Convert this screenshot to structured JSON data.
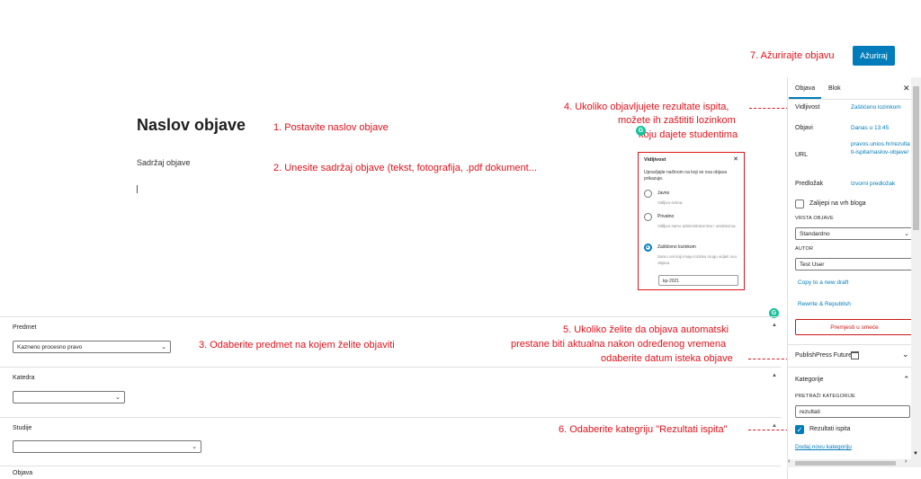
{
  "topbar": {
    "update_label": "Ažuriraj",
    "step7": "7. Ažurirajte objavu"
  },
  "editor": {
    "title": "Naslov objave",
    "content_placeholder": "Sadržaj objave"
  },
  "instructions": {
    "step1": "1. Postavite naslov objave",
    "step2": "2. Unesite sadržaj objave (tekst, fotografija, .pdf dokument...",
    "step3": "3. Odaberite predmet na kojem želite objaviti",
    "step4_line1": "4. Ukoliko objavljujete rezultate ispita,",
    "step4_line2": "možete ih zaštititi lozinkom",
    "step4_line3": "koju dajete studentima",
    "step5_line1": "5. Ukoliko želite da objava automatski",
    "step5_line2": "prestane biti aktualna nakon određenog vremena",
    "step5_line3": "odaberite datum isteka objave",
    "step6": "6. Odaberite kategriju \"Rezultati ispita\""
  },
  "visibility_popup": {
    "title": "Vidljivost",
    "intro": "Upravljajte načinom na koji se ova objava prikazuje.",
    "options": [
      {
        "label": "Javno",
        "desc": "Vidljivo svima."
      },
      {
        "label": "Privatno",
        "desc": "Vidljivo samo administratorima i urednicima."
      },
      {
        "label": "Zaštićeno lozinkom",
        "desc": "Samo oni koji imaju lozinku mogu vidjeti ovu objavu."
      }
    ],
    "selected": 2,
    "password": "kp-2021"
  },
  "meta": {
    "predmet_label": "Predmet",
    "predmet_value": "Kazneno procesno pravo",
    "katedra_label": "Katedra",
    "katedra_value": "",
    "studije_label": "Studije",
    "studije_value": "",
    "objava_label": "Objava"
  },
  "sidebar": {
    "tab_post": "Objava",
    "tab_block": "Blok",
    "rows": [
      {
        "label": "Vidljivost",
        "value": "Zaštićeno lozinkom"
      },
      {
        "label": "Objavi",
        "value": "Danas u 13:45"
      },
      {
        "label": "URL",
        "value": "pravos.unios.hr/rezultati-ispita/naslov-objave/"
      },
      {
        "label": "Predložak",
        "value": "Izvorni predložak"
      }
    ],
    "sticky_label": "Zalijepi na vrh bloga",
    "post_type_caption": "VRSTA OBJAVE",
    "post_type_value": "Standardno",
    "author_caption": "AUTOR",
    "author_value": "Test User",
    "copy_link": "Copy to a new draft",
    "rewrite_link": "Rewrite & Republish",
    "trash_label": "Premjesti u smeće",
    "future_label": "PublishPress Future",
    "categories_label": "Kategorije",
    "search_caption": "PRETRAŽI KATEGORIJE",
    "search_value": "rezultati",
    "category_item": "Rezultati ispita",
    "add_category": "Dodaj novu kategoriju"
  },
  "colors": {
    "accent": "#007cba",
    "annotation": "#e0121b",
    "trash": "#cc1818"
  }
}
